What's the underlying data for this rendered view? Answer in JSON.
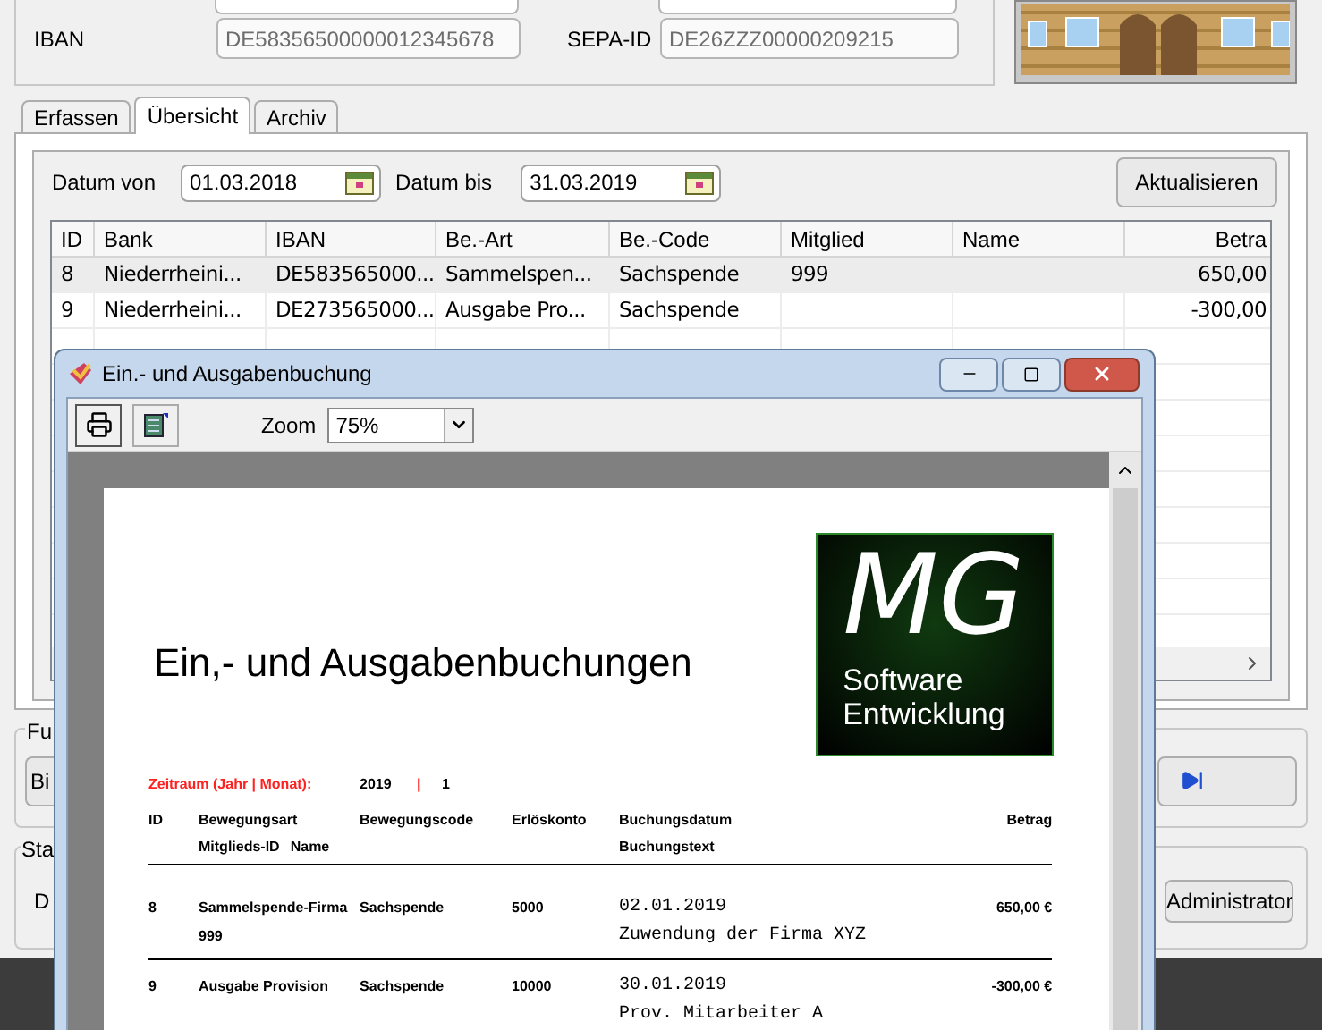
{
  "account": {
    "fields": [
      {
        "label": "IBAN",
        "value": "DE58356500000012345678",
        "disabled": true
      },
      {
        "label": "SEPA-ID",
        "value": "DE26ZZZ00000209215",
        "disabled": true
      }
    ]
  },
  "tabs": [
    {
      "label": "Erfassen",
      "selected": false
    },
    {
      "label": "Übersicht",
      "selected": true
    },
    {
      "label": "Archiv",
      "selected": false
    }
  ],
  "overview": {
    "date_from": {
      "label": "Datum von",
      "value": "01.03.2018"
    },
    "date_to": {
      "label": "Datum bis",
      "value": "31.03.2019"
    },
    "refresh_button": "Aktualisieren",
    "table": {
      "columns": [
        "ID",
        "Bank",
        "IBAN",
        "Be.-Art",
        "Be.-Code",
        "Mitglied",
        "Name",
        "Betra"
      ],
      "rows": [
        {
          "selected": true,
          "cells": [
            "8",
            "Niederrheini...",
            "DE583565000...",
            "Sammelspen...",
            "Sachspende",
            "999",
            "",
            "650,00"
          ]
        },
        {
          "selected": false,
          "cells": [
            "9",
            "Niederrheini...",
            "DE273565000...",
            "Ausgabe Pro...",
            "Sachspende",
            "",
            "",
            "-300,00"
          ]
        }
      ]
    }
  },
  "group_1": {
    "label": "Fu",
    "button": "Bi"
  },
  "group_2": {
    "label": "Sta",
    "text": "D",
    "button": "Administrator"
  },
  "dialog": {
    "title": "Ein.- und Ausgabenbuchung",
    "zoom": {
      "label": "Zoom",
      "value": "75%"
    },
    "report": {
      "title": "Ein,- und Ausgabenbuchungen",
      "logo": {
        "mark": "MG",
        "line_1": "Software",
        "line_2": "Entwicklung"
      },
      "period": {
        "label": "Zeitraum (Jahr | Monat):",
        "year": "2019",
        "separator": "|",
        "month": "1"
      },
      "headers": [
        "ID",
        "Bewegungsart",
        "Bewegungscode",
        "Erlöskonto",
        "Buchungsdatum",
        "Betrag"
      ],
      "sub_headers": {
        "member_id": "Mitglieds-ID",
        "name": "Name",
        "text": "Buchungstext"
      },
      "rows": [
        {
          "id": "8",
          "type": "Sammelspende-Firma",
          "code": "Sachspende",
          "account": "5000",
          "date": "02.01.2019",
          "amount": "650,00 €",
          "member": "999",
          "text": "Zuwendung der Firma XYZ"
        },
        {
          "id": "9",
          "type": "Ausgabe Provision",
          "code": "Sachspende",
          "account": "10000",
          "date": "30.01.2019",
          "amount": "-300,00 €",
          "text": "Prov. Mitarbeiter A"
        }
      ]
    }
  }
}
